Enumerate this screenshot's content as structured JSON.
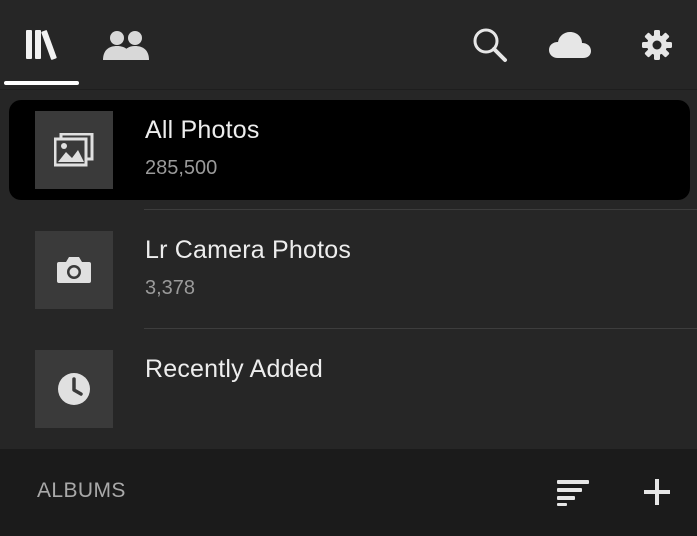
{
  "header": {
    "tabs": [
      {
        "name": "library",
        "icon": "library-icon",
        "active": true
      },
      {
        "name": "people",
        "icon": "people-icon",
        "active": false
      }
    ],
    "actions": [
      {
        "name": "search",
        "icon": "search-icon"
      },
      {
        "name": "cloud-sync",
        "icon": "cloud-icon"
      },
      {
        "name": "settings",
        "icon": "gear-icon"
      }
    ]
  },
  "collections": [
    {
      "title": "All Photos",
      "count": "285,500",
      "icon": "image-stack-icon",
      "selected": true
    },
    {
      "title": "Lr Camera Photos",
      "count": "3,378",
      "icon": "camera-icon",
      "selected": false
    },
    {
      "title": "Recently Added",
      "count": "",
      "icon": "clock-icon",
      "selected": false
    }
  ],
  "albums_bar": {
    "label": "ALBUMS",
    "sort_icon": "sort-icon",
    "add_icon": "plus-icon"
  },
  "colors": {
    "background": "#262626",
    "selected_row": "#000000",
    "thumbnail": "#3a3a3a",
    "bottom_bar": "#1b1b1b",
    "active_tab_underline": "#ffffff"
  }
}
